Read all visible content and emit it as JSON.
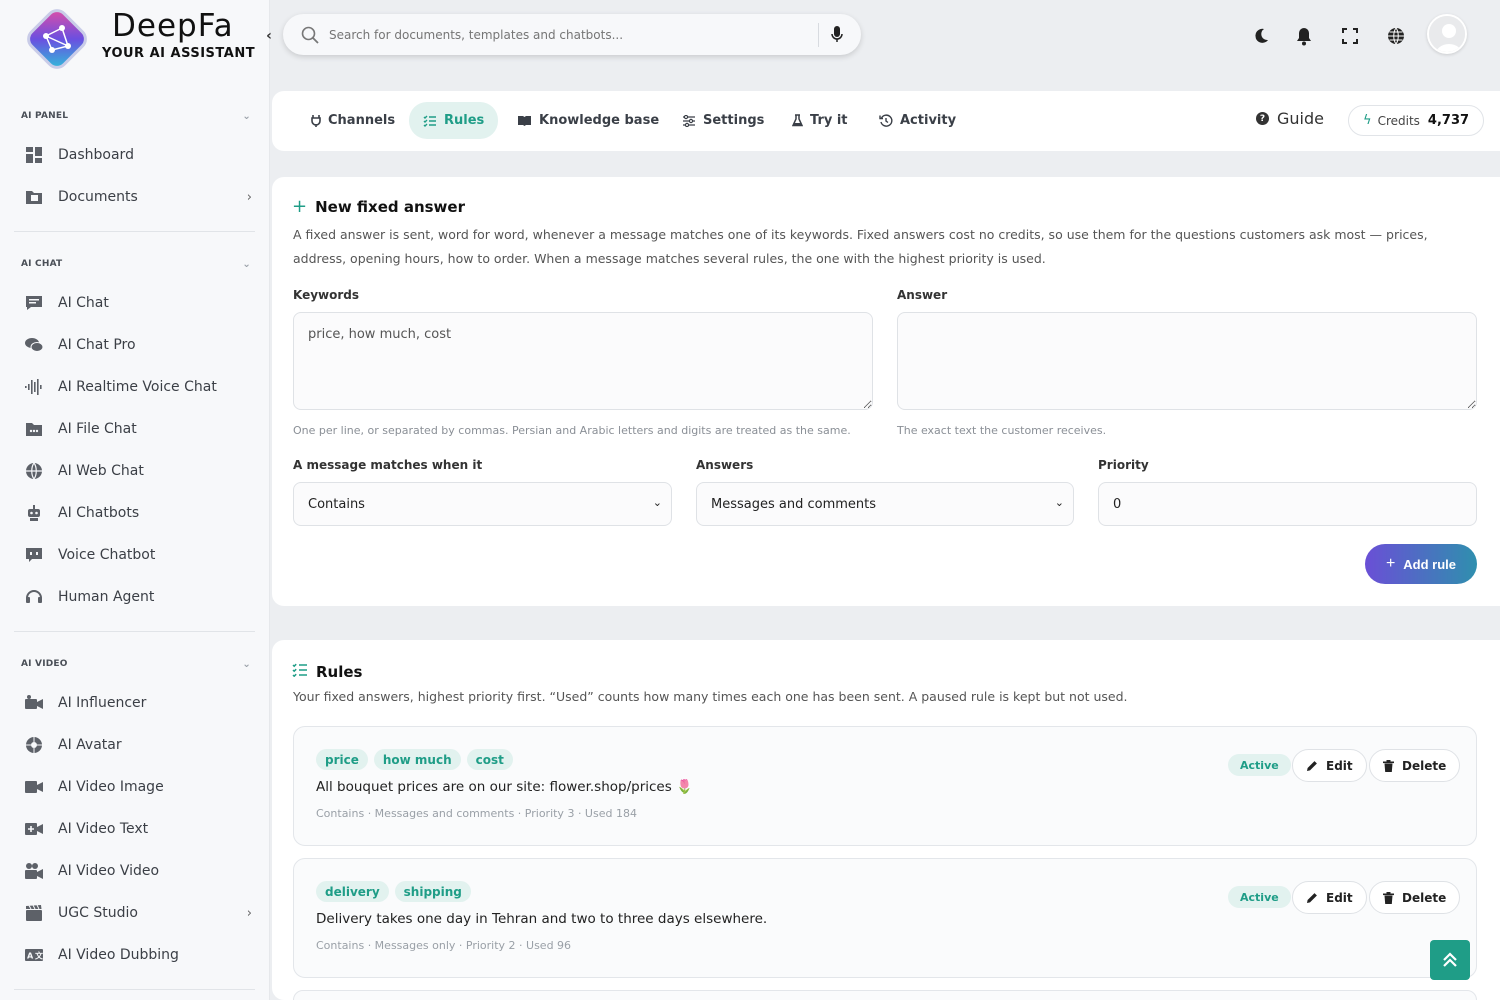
{
  "brand": {
    "name": "DeepFa",
    "tagline": "YOUR AI ASSISTANT"
  },
  "sidebar": {
    "sections": [
      {
        "title": "AI PANEL",
        "items": [
          {
            "label": "Dashboard",
            "icon": "dashboard-icon",
            "has_arrow": false
          },
          {
            "label": "Documents",
            "icon": "folder-icon",
            "has_arrow": true
          }
        ]
      },
      {
        "title": "AI CHAT",
        "items": [
          {
            "label": "AI Chat",
            "icon": "chat-icon"
          },
          {
            "label": "AI Chat Pro",
            "icon": "chats-icon"
          },
          {
            "label": "AI Realtime Voice Chat",
            "icon": "waveform-icon"
          },
          {
            "label": "AI File Chat",
            "icon": "file-chat-icon"
          },
          {
            "label": "AI Web Chat",
            "icon": "globe-icon"
          },
          {
            "label": "AI Chatbots",
            "icon": "robot-icon"
          },
          {
            "label": "Voice Chatbot",
            "icon": "voice-bot-icon"
          },
          {
            "label": "Human Agent",
            "icon": "headset-icon"
          }
        ]
      },
      {
        "title": "AI VIDEO",
        "items": [
          {
            "label": "AI Influencer",
            "icon": "video-person-icon"
          },
          {
            "label": "AI Avatar",
            "icon": "aperture-icon"
          },
          {
            "label": "AI Video Image",
            "icon": "video-camera-icon"
          },
          {
            "label": "AI Video Text",
            "icon": "video-plus-icon"
          },
          {
            "label": "AI Video Video",
            "icon": "film-camera-icon"
          },
          {
            "label": "UGC Studio",
            "icon": "clapper-icon",
            "has_arrow": true
          },
          {
            "label": "AI Video Dubbing",
            "icon": "translate-icon"
          }
        ]
      }
    ]
  },
  "search": {
    "placeholder": "Search for documents, templates and chatbots..."
  },
  "tabs": [
    {
      "label": "Channels",
      "icon": "plug-icon",
      "active": false
    },
    {
      "label": "Rules",
      "icon": "checklist-icon",
      "active": true
    },
    {
      "label": "Knowledge base",
      "icon": "book-icon",
      "active": false
    },
    {
      "label": "Settings",
      "icon": "sliders-icon",
      "active": false
    },
    {
      "label": "Try it",
      "icon": "flask-icon",
      "active": false
    },
    {
      "label": "Activity",
      "icon": "history-icon",
      "active": false
    }
  ],
  "guide": {
    "label": "Guide"
  },
  "credits": {
    "label": "Credits",
    "value": "4,737"
  },
  "new_answer": {
    "title": "New fixed answer",
    "description": "A fixed answer is sent, word for word, whenever a message matches one of its keywords. Fixed answers cost no credits, so use them for the questions customers ask most — prices, address, opening hours, how to order. When a message matches several rules, the one with the highest priority is used.",
    "keywords_label": "Keywords",
    "keywords_value": "price, how much, cost",
    "keywords_hint": "One per line, or separated by commas. Persian and Arabic letters and digits are treated as the same.",
    "answer_label": "Answer",
    "answer_value": "",
    "answer_hint": "The exact text the customer receives.",
    "match_label": "A message matches when it",
    "match_value": "Contains",
    "answers_label": "Answers",
    "answers_value": "Messages and comments",
    "priority_label": "Priority",
    "priority_value": "0",
    "add_button": "Add rule"
  },
  "rules": {
    "title": "Rules",
    "description": "Your fixed answers, highest priority first. “Used” counts how many times each one has been sent. A paused rule is kept but not used.",
    "items": [
      {
        "keywords": [
          "price",
          "how much",
          "cost"
        ],
        "text": "All bouquet prices are on our site: flower.shop/prices 🌷",
        "meta": "Contains · Messages and comments · Priority 3 · Used 184",
        "status": "Active"
      },
      {
        "keywords": [
          "delivery",
          "shipping"
        ],
        "text": "Delivery takes one day in Tehran and two to three days elsewhere.",
        "meta": "Contains · Messages only · Priority 2 · Used 96",
        "status": "Active"
      }
    ],
    "edit_label": "Edit",
    "delete_label": "Delete"
  },
  "colors": {
    "accent": "#1f9d87",
    "accent_soft": "#e2f2ef",
    "button_gradient_start": "#6a4fd6",
    "button_gradient_end": "#2f8fae"
  }
}
